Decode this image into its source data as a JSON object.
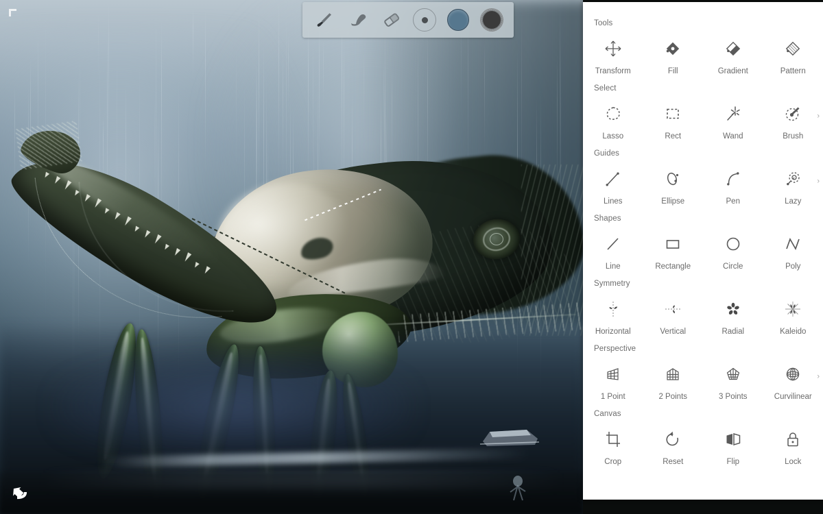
{
  "app": {
    "canvas_artwork_description": "Digital painting of a giant praying-mantis-like creature in misty blue-grey rain"
  },
  "canvas": {
    "corner_marker": "crop-corner-marker",
    "undo_icon": "undo-arrow-icon"
  },
  "top_toolbar": {
    "items": [
      {
        "name": "brush-tool",
        "icon": "paintbrush-icon",
        "label": "Brush"
      },
      {
        "name": "smudge-tool",
        "icon": "smudge-icon",
        "label": "Smudge"
      },
      {
        "name": "eraser-tool",
        "icon": "eraser-icon",
        "label": "Eraser"
      },
      {
        "name": "brush-size",
        "icon": "size-circle-icon",
        "label": "Size"
      },
      {
        "name": "color-swatch",
        "icon": "color-swatch-icon",
        "label": "Color",
        "color": "#56778e"
      },
      {
        "name": "brush-preview",
        "icon": "brush-preview-icon",
        "label": "Brush Preview",
        "color": "#3b3b3b"
      }
    ]
  },
  "tools_panel": {
    "sections": [
      {
        "label": "Tools",
        "chevron": "",
        "items": [
          {
            "label": "Transform",
            "icon": "transform-move-icon"
          },
          {
            "label": "Fill",
            "icon": "fill-diamond-icon"
          },
          {
            "label": "Gradient",
            "icon": "gradient-diamond-icon"
          },
          {
            "label": "Pattern",
            "icon": "pattern-diamond-icon"
          }
        ]
      },
      {
        "label": "Select",
        "chevron": "›",
        "items": [
          {
            "label": "Lasso",
            "icon": "lasso-select-icon"
          },
          {
            "label": "Rect",
            "icon": "rect-select-icon"
          },
          {
            "label": "Wand",
            "icon": "magic-wand-icon"
          },
          {
            "label": "Brush",
            "icon": "brush-select-icon"
          }
        ]
      },
      {
        "label": "Guides",
        "chevron": "›",
        "items": [
          {
            "label": "Lines",
            "icon": "guide-line-icon"
          },
          {
            "label": "Ellipse",
            "icon": "guide-ellipse-icon"
          },
          {
            "label": "Pen",
            "icon": "guide-pen-icon"
          },
          {
            "label": "Lazy",
            "icon": "lazy-mouse-icon"
          }
        ]
      },
      {
        "label": "Shapes",
        "chevron": "",
        "items": [
          {
            "label": "Line",
            "icon": "shape-line-icon"
          },
          {
            "label": "Rectangle",
            "icon": "shape-rectangle-icon"
          },
          {
            "label": "Circle",
            "icon": "shape-circle-icon"
          },
          {
            "label": "Poly",
            "icon": "shape-poly-icon"
          }
        ]
      },
      {
        "label": "Symmetry",
        "chevron": "",
        "items": [
          {
            "label": "Horizontal",
            "icon": "symmetry-horizontal-icon"
          },
          {
            "label": "Vertical",
            "icon": "symmetry-vertical-icon"
          },
          {
            "label": "Radial",
            "icon": "symmetry-radial-icon"
          },
          {
            "label": "Kaleido",
            "icon": "symmetry-kaleido-icon"
          }
        ]
      },
      {
        "label": "Perspective",
        "chevron": "›",
        "items": [
          {
            "label": "1 Point",
            "icon": "perspective-1-point-icon"
          },
          {
            "label": "2 Points",
            "icon": "perspective-2-points-icon"
          },
          {
            "label": "3 Points",
            "icon": "perspective-3-points-icon"
          },
          {
            "label": "Curvilinear",
            "icon": "perspective-curvilinear-icon"
          }
        ]
      },
      {
        "label": "Canvas",
        "chevron": "",
        "items": [
          {
            "label": "Crop",
            "icon": "crop-icon"
          },
          {
            "label": "Reset",
            "icon": "reset-rotate-icon"
          },
          {
            "label": "Flip",
            "icon": "flip-icon"
          },
          {
            "label": "Lock",
            "icon": "lock-icon"
          }
        ]
      }
    ]
  },
  "colors": {
    "panel_bg": "#ffffff",
    "label_text": "#6a6a6a",
    "icon_stroke": "#5a5a5a",
    "toolbar_bg": "#c5ced3",
    "accent_color": "#56778e"
  }
}
